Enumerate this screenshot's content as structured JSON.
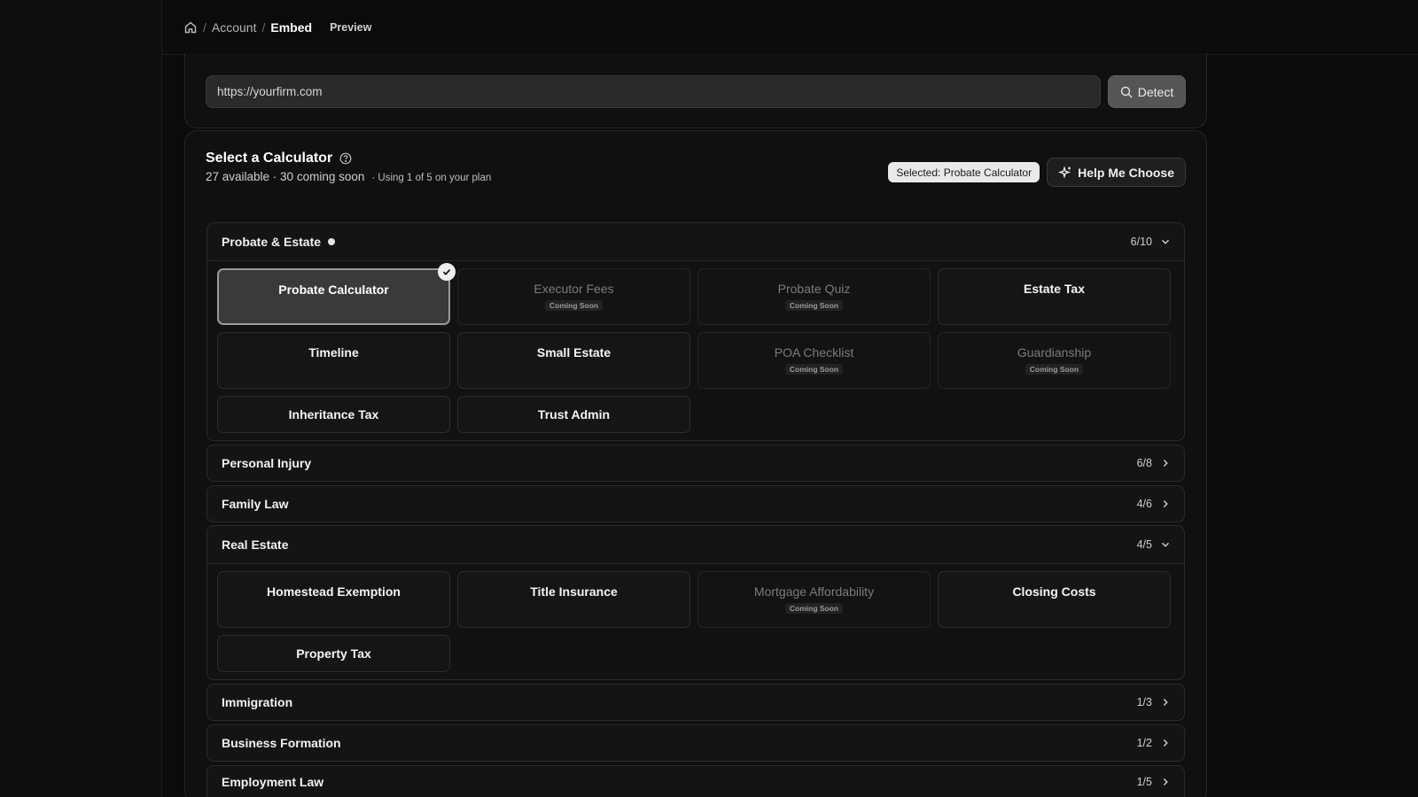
{
  "breadcrumb": {
    "sep": "/",
    "account": "Account",
    "embed": "Embed",
    "preview": "Preview"
  },
  "url": {
    "value": "https://yourfirm.com",
    "detect_label": "Detect"
  },
  "calculator": {
    "title": "Select a Calculator",
    "available": "27 available · 30 coming soon",
    "plan": "· Using 1 of 5 on your plan",
    "selected_badge": "Selected: Probate Calculator",
    "help_label": "Help Me Choose"
  },
  "coming_soon": "Coming Soon",
  "categories": {
    "probate": {
      "name": "Probate & Estate",
      "count": "6/10",
      "tiles": [
        {
          "label": "Probate Calculator"
        },
        {
          "label": "Executor Fees"
        },
        {
          "label": "Probate Quiz"
        },
        {
          "label": "Estate Tax"
        },
        {
          "label": "Timeline"
        },
        {
          "label": "Small Estate"
        },
        {
          "label": "POA Checklist"
        },
        {
          "label": "Guardianship"
        },
        {
          "label": "Inheritance Tax"
        },
        {
          "label": "Trust Admin"
        }
      ]
    },
    "personal_injury": {
      "name": "Personal Injury",
      "count": "6/8"
    },
    "family_law": {
      "name": "Family Law",
      "count": "4/6"
    },
    "real_estate": {
      "name": "Real Estate",
      "count": "4/5",
      "tiles": [
        {
          "label": "Homestead Exemption"
        },
        {
          "label": "Title Insurance"
        },
        {
          "label": "Mortgage Affordability"
        },
        {
          "label": "Closing Costs"
        },
        {
          "label": "Property Tax"
        }
      ]
    },
    "immigration": {
      "name": "Immigration",
      "count": "1/3"
    },
    "business_formation": {
      "name": "Business Formation",
      "count": "1/2"
    },
    "employment_law": {
      "name": "Employment Law",
      "count": "1/5"
    }
  }
}
